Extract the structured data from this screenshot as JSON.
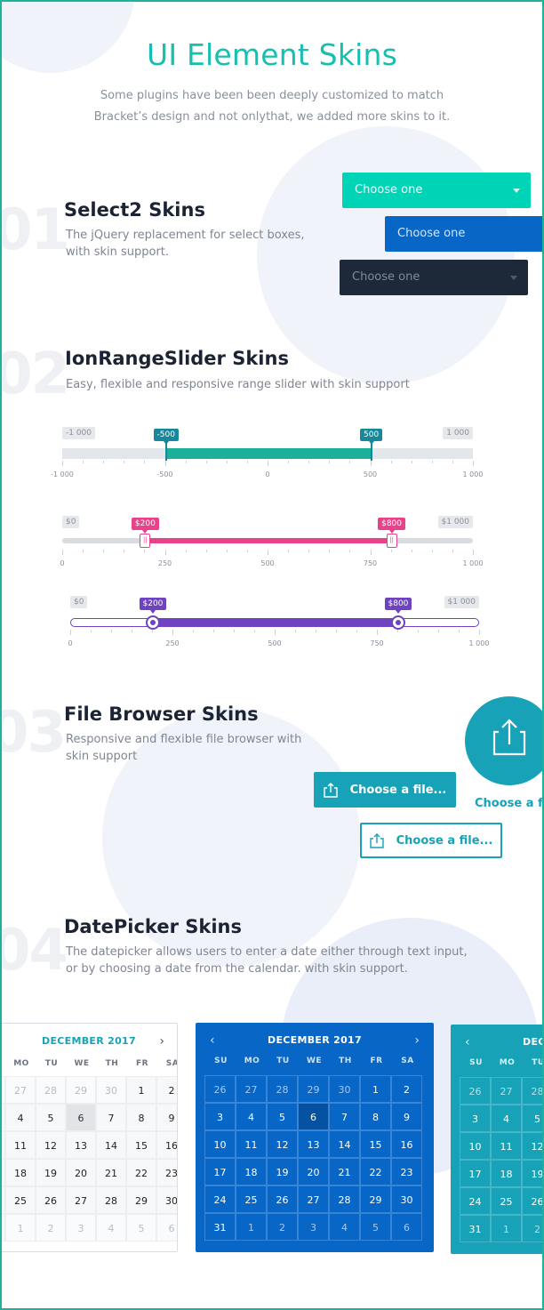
{
  "header": {
    "title": "UI Element Skins",
    "subtitle_line1": "Some plugins have been been deeply customized to match",
    "subtitle_line2": "Bracket’s design and not onlythat, we added more skins to it."
  },
  "sections": [
    {
      "num": "01",
      "title": "Select2 Skins",
      "desc_line1": "The jQuery replacement for select boxes,",
      "desc_line2": "with skin support."
    },
    {
      "num": "02",
      "title": "IonRangeSlider Skins",
      "desc_line1": "Easy, flexible and responsive range slider with skin support",
      "desc_line2": ""
    },
    {
      "num": "03",
      "title": "File Browser Skins",
      "desc_line1": "Responsive and flexible file browser with",
      "desc_line2": "skin support"
    },
    {
      "num": "04",
      "title": "DatePicker Skins",
      "desc_line1": "The datepicker allows users to enter a date either through text input,",
      "desc_line2": "or by choosing a date from the calendar. with skin support."
    }
  ],
  "selects": [
    {
      "value": "Choose one",
      "bg": "#00d4b6",
      "color": "#ffffff"
    },
    {
      "value": "Choose one",
      "bg": "#0866c6",
      "color": "#ffffff"
    },
    {
      "value": "Choose one",
      "bg": "#1d2939",
      "color": "#7f8b9c"
    }
  ],
  "sliders": [
    {
      "color": "#1caf9a",
      "min_label": "-1 000",
      "max_label": "1 000",
      "from_label": "-500",
      "to_label": "500",
      "from": -500,
      "to": 500,
      "min": -1000,
      "max": 1000,
      "ticks": [
        "-1 000",
        "-500",
        "0",
        "500",
        "1 000"
      ]
    },
    {
      "color": "#e8428a",
      "min_label": "$0",
      "max_label": "$1 000",
      "from_label": "$200",
      "to_label": "$800",
      "from": 200,
      "to": 800,
      "min": 0,
      "max": 1000,
      "ticks": [
        "0",
        "250",
        "500",
        "750",
        "1 000"
      ]
    },
    {
      "color": "#6f42c1",
      "min_label": "$0",
      "max_label": "$1 000",
      "from_label": "$200",
      "to_label": "$800",
      "from": 200,
      "to": 800,
      "min": 0,
      "max": 1000,
      "ticks": [
        "0",
        "250",
        "500",
        "750",
        "1 000"
      ]
    }
  ],
  "file_browser": {
    "button_label": "Choose a file...",
    "circle_label": "Choose a file",
    "accent": "#17a2b8"
  },
  "datepicker": {
    "month": "DECEMBER 2017",
    "dows": [
      "SU",
      "MO",
      "TU",
      "WE",
      "TH",
      "FR",
      "SA"
    ],
    "weeks": [
      [
        "26",
        "27",
        "28",
        "29",
        "30",
        "1",
        "2"
      ],
      [
        "3",
        "4",
        "5",
        "6",
        "7",
        "8",
        "9"
      ],
      [
        "10",
        "11",
        "12",
        "13",
        "14",
        "15",
        "16"
      ],
      [
        "17",
        "18",
        "19",
        "20",
        "21",
        "22",
        "23"
      ],
      [
        "24",
        "25",
        "26",
        "27",
        "28",
        "29",
        "30"
      ],
      [
        "31",
        "1",
        "2",
        "3",
        "4",
        "5",
        "6"
      ]
    ],
    "selected": "6",
    "colors": {
      "light_bg": "#ffffff",
      "blue": "#0866c6",
      "teal": "#17a2b8"
    }
  }
}
